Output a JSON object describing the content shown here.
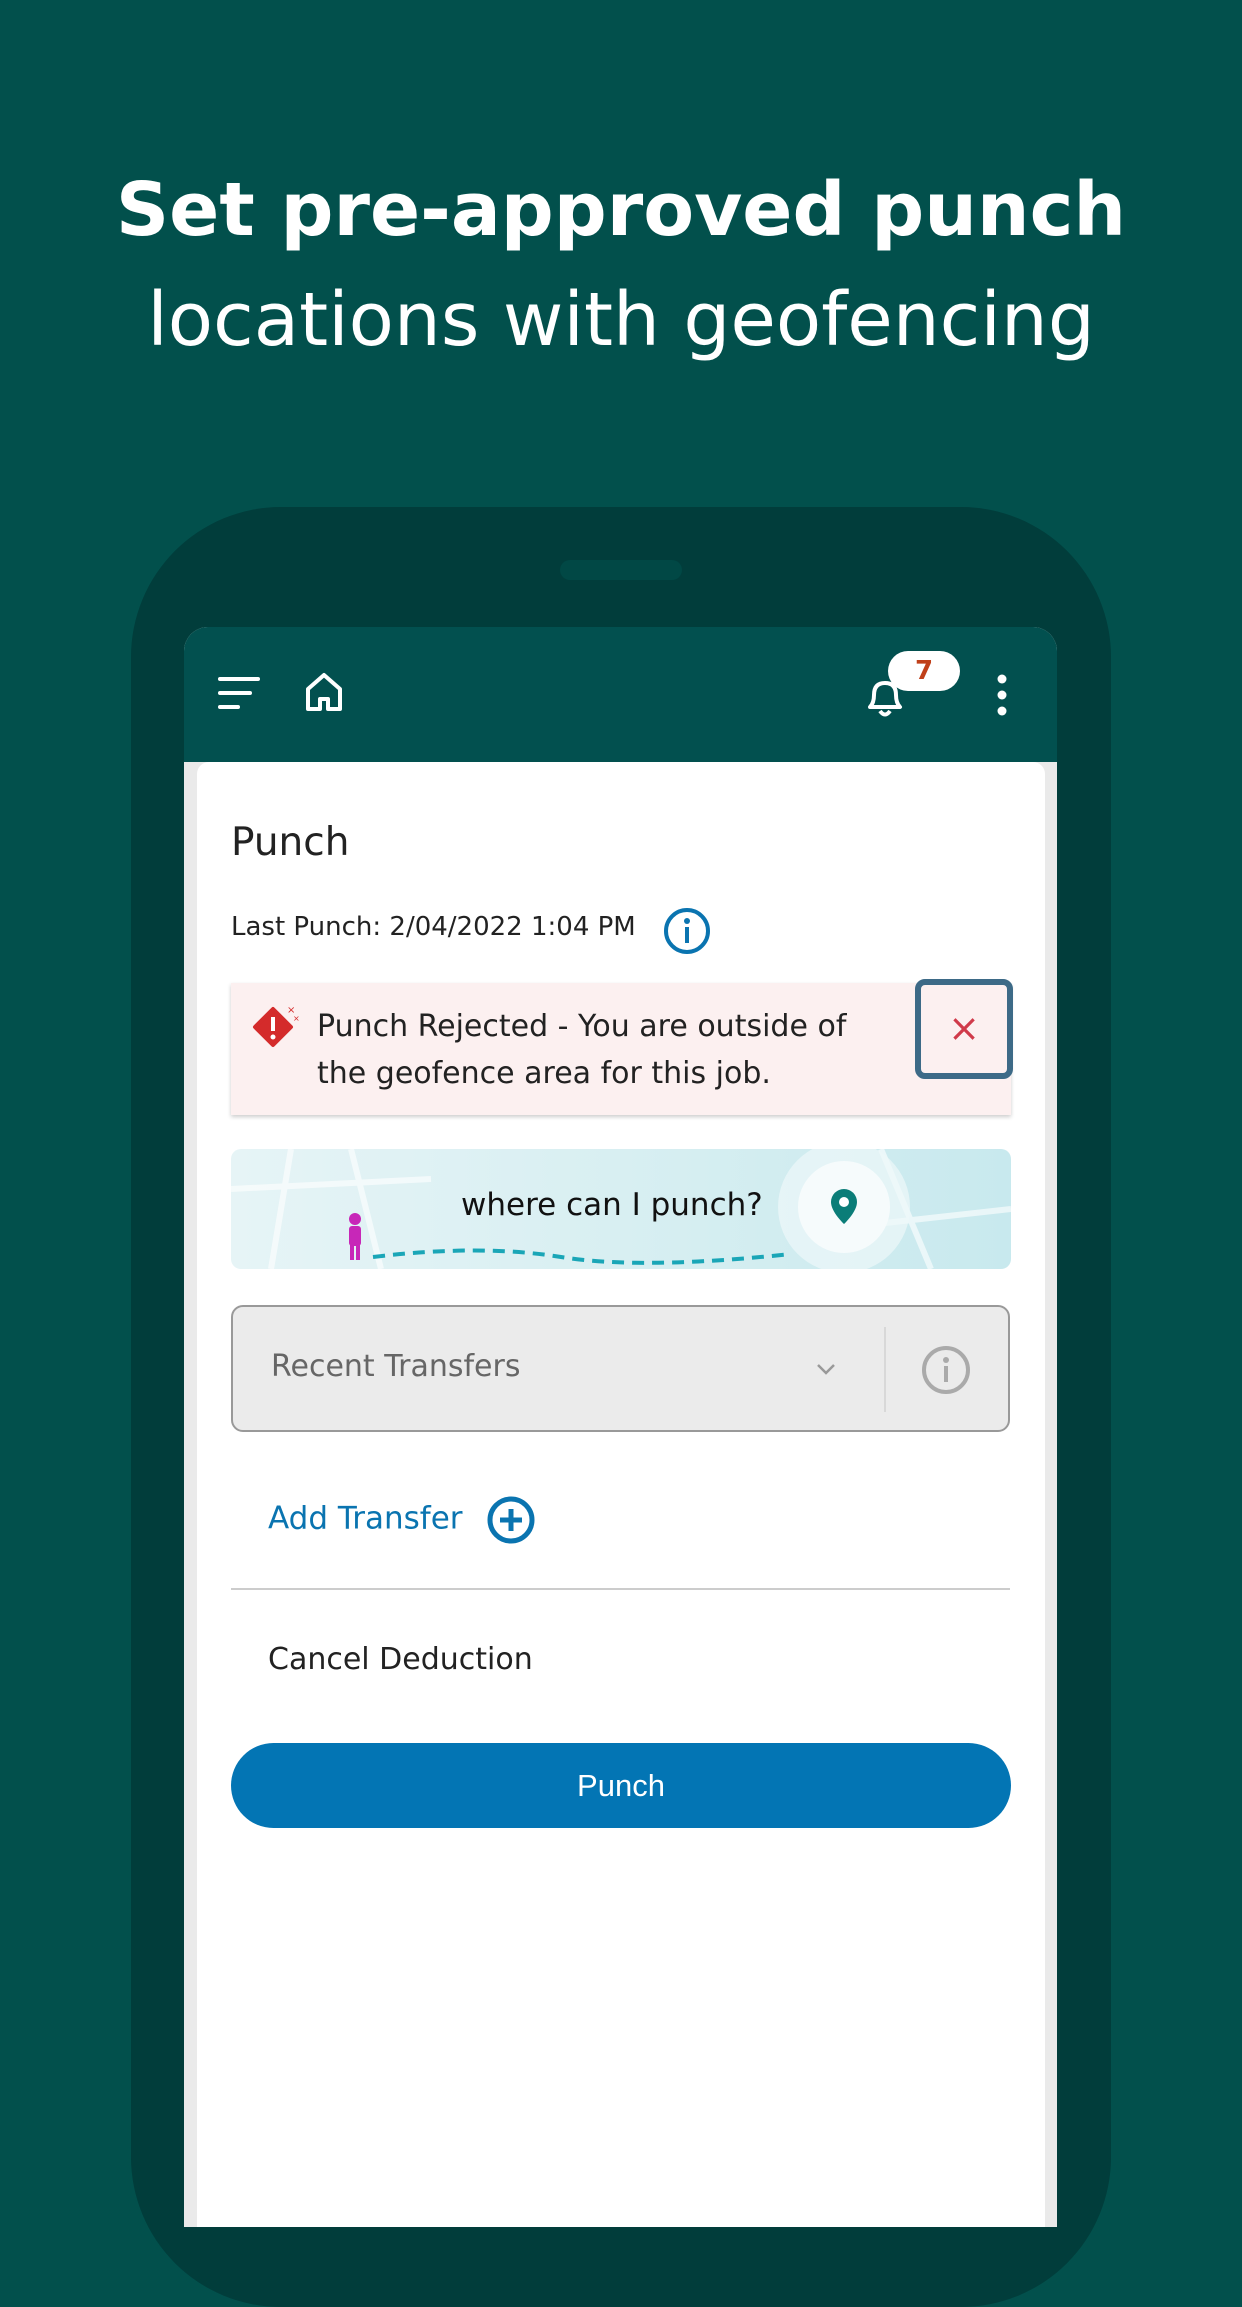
{
  "headline": {
    "line1": "Set pre-approved punch",
    "line2": "locations with geofencing"
  },
  "appbar": {
    "notification_count": "7",
    "icons": [
      "menu-icon",
      "home-icon",
      "bell-icon",
      "more-vertical-icon"
    ]
  },
  "page": {
    "title": "Punch",
    "last_punch": "Last Punch: 2/04/2022 1:04 PM"
  },
  "alert": {
    "message": "Punch Rejected - You are outside of the geofence area for this job.",
    "close_label": "×",
    "color": "#d42b2b"
  },
  "map_banner": {
    "label": "where can I punch?"
  },
  "transfers": {
    "placeholder": "Recent Transfers",
    "add_label": "Add Transfer"
  },
  "cancel_deduction": {
    "label": "Cancel Deduction",
    "enabled": false
  },
  "punch_button": {
    "label": "Punch",
    "color": "#0375b4"
  }
}
